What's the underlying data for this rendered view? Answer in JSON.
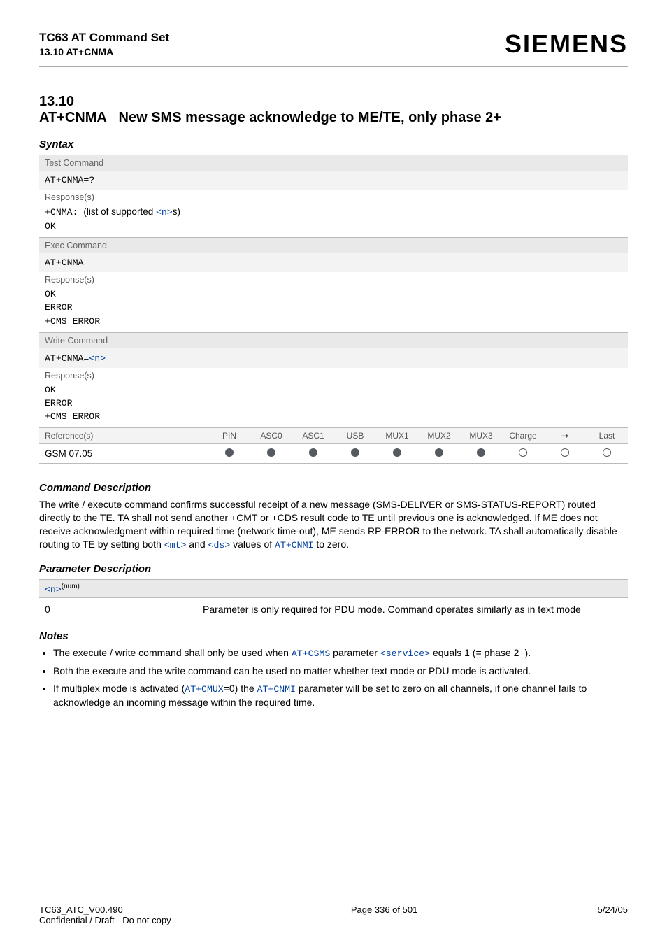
{
  "header": {
    "title_main": "TC63 AT Command Set",
    "title_sub": "13.10 AT+CNMA",
    "logo": "SIEMENS"
  },
  "section": {
    "number": "13.10",
    "command": "AT+CNMA",
    "title_rest": "New SMS message acknowledge to ME/TE, only phase 2+"
  },
  "labels": {
    "syntax": "Syntax",
    "command_description": "Command Description",
    "parameter_description": "Parameter Description",
    "notes": "Notes",
    "test_command": "Test Command",
    "exec_command": "Exec Command",
    "write_command": "Write Command",
    "responses": "Response(s)",
    "references": "Reference(s)"
  },
  "syntax": {
    "test_cmd": "AT+CNMA=?",
    "test_resp_prefix": "+CNMA: ",
    "test_resp_tail_a": "(list of supported ",
    "test_resp_tail_n": "<n>",
    "test_resp_tail_b": "s)",
    "ok": "OK",
    "exec_cmd": "AT+CNMA",
    "error": "ERROR",
    "cms_error": "+CMS ERROR",
    "write_cmd_prefix": "AT+CNMA=",
    "write_cmd_param": "<n>"
  },
  "matrix": {
    "cols": [
      "PIN",
      "ASC0",
      "ASC1",
      "USB",
      "MUX1",
      "MUX2",
      "MUX3",
      "Charge",
      "➝",
      "Last"
    ],
    "reference_value": "GSM 07.05",
    "values": [
      "f",
      "f",
      "f",
      "f",
      "f",
      "f",
      "f",
      "e",
      "e",
      "e"
    ]
  },
  "command_description": {
    "p1a": "The write / execute command confirms successful receipt of a new message (SMS-DELIVER or SMS-STATUS-REPORT) routed directly to the TE. TA shall not send another +CMT or +CDS result code to TE until previous one is acknowledged. If ME does not receive acknowledgment within required time (network time-out), ME sends RP-ERROR to the network. TA shall automatically disable routing to TE by setting both ",
    "mt": "<mt>",
    "p1b": " and ",
    "ds": "<ds>",
    "p1c": " values of ",
    "cnmi": "AT+CNMI",
    "p1d": " to zero."
  },
  "parameter": {
    "name": "<n>",
    "type": "(num)",
    "value": "0",
    "desc": "Parameter is only required for PDU mode. Command operates similarly as in text mode"
  },
  "notes": {
    "n1a": "The execute / write command shall only be used when ",
    "csms": "AT+CSMS",
    "n1b": " parameter ",
    "service": "<service>",
    "n1c": " equals 1 (= phase 2+).",
    "n2": "Both the execute and the write command can be used no matter whether text mode or PDU mode is activated.",
    "n3a": "If multiplex mode is activated (",
    "cmux": "AT+CMUX",
    "n3b": "=0) the ",
    "cnmi2": "AT+CNMI",
    "n3c": " parameter will be set to zero on all channels, if one channel fails to acknowledge an incoming message within the required time."
  },
  "footer": {
    "left1": "TC63_ATC_V00.490",
    "left2": "Confidential / Draft - Do not copy",
    "center": "Page 336 of 501",
    "right": "5/24/05"
  }
}
